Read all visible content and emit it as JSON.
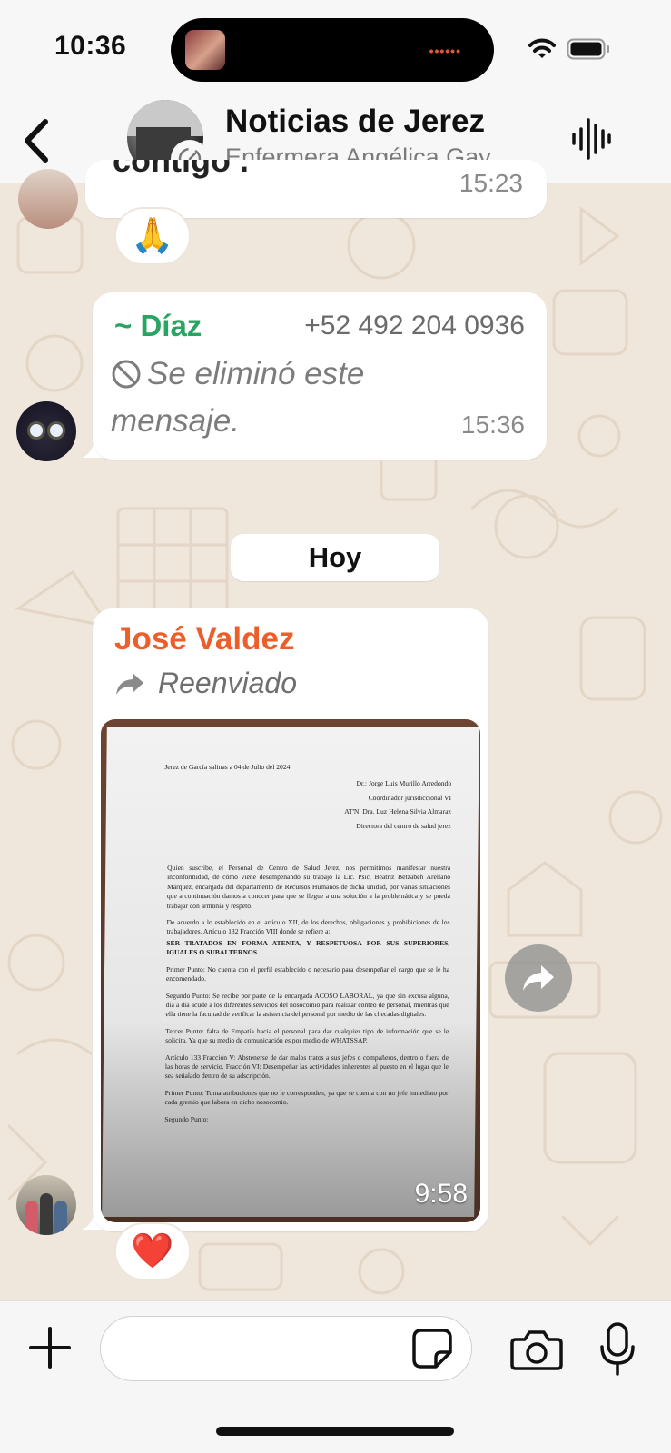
{
  "status_bar": {
    "time": "10:36",
    "island_dots": "••••••"
  },
  "header": {
    "title": "Noticias de Jerez",
    "subtitle": "Enfermera Angélica Gay…"
  },
  "messages": {
    "top": {
      "text": "contigo .",
      "time": "15:23",
      "reaction": "🙏"
    },
    "diaz": {
      "sender": "~ Díaz",
      "phone": "+52 492 204 0936",
      "text": "Se eliminó este mensaje.",
      "time": "15:36"
    },
    "date_chip": "Hoy",
    "jose": {
      "sender": "José Valdez",
      "forwarded": "Reenviado",
      "time": "9:58",
      "reaction": "❤️",
      "document": {
        "date_line": "Jerez de García salinas a 04 de Julio del 2024.",
        "to_1": "Dr.: Jorge Luis Murillo Arredondo",
        "to_2": "Coordinador jurisdiccional VI",
        "to_3": "AT'N. Dra. Luz Helena Silvia Almaraz",
        "to_4": "Directora del centro de salud jerez",
        "p1": "Quien suscribe, el Personal de Centro de Salud Jerez, nos permitimos manifestar nuestra inconformidad, de cómo viene desempeñando su trabajo la Lic. Psic. Beatriz Betzabeh Arellano Márquez, encargada del departamento de Recursos Humanos de dicha unidad, por varias situaciones que a continuación damos a conocer para que se llegue a una solución a la problemática y se pueda trabajar con armonía y respeto.",
        "p2": "De acuerdo a lo establecido en el artículo XII, de los derechos, obligaciones y prohibiciones de los trabajadores. Artículo 132 Fracción VIII donde se refiere a:",
        "p2_bold": "SER TRATADOS EN FORMA ATENTA, Y RESPETUOSA POR SUS SUPERIORES, IGUALES O SUBALTERNOS.",
        "p3": "Primer Punto: No cuenta con el perfil establecido o necesario para desempeñar el cargo que se le ha encomendado.",
        "p4": "Segundo Punto: Se recibe por parte de la encargada ACOSO LABORAL, ya que sin excusa alguna, día a día acude a los diferentes servicios del nosocomio para realizar conteo de personal, mientras que ella tiene la facultad de verificar la asistencia del personal por medio de las checadas digitales.",
        "p5": "Tercer Punto: falta de Empatía hacia el personal para dar cualquier tipo de información que se le solicita. Ya que su medio de comunicación es por medio de WHATSSAP.",
        "p6": "Artículo 133 Fracción V: Abstenerse de dar malos tratos a sus jefes o compañeros, dentro o fuera de las horas de servicio. Fracción VI: Desempeñar las actividades inherentes al puesto en el lugar que le sea señalado dentro de su adscripción.",
        "p7": "Primer Punto: Toma atribuciones que no le corresponden, ya que se cuenta con un jefe inmediato por cada gremio que labora en dicho nosocomio.",
        "p8": "Segundo Punto:"
      }
    }
  },
  "composer": {
    "placeholder": ""
  },
  "colors": {
    "diaz_sender": "#2aa462",
    "jose_sender": "#ec5f2a",
    "wallpaper": "#efe7dc"
  },
  "icons": [
    "back-icon",
    "community-icon",
    "voice-chat-icon",
    "deleted-icon",
    "forward-icon",
    "plus-icon",
    "sticker-icon",
    "camera-icon",
    "microphone-icon",
    "wifi-icon",
    "battery-icon"
  ]
}
